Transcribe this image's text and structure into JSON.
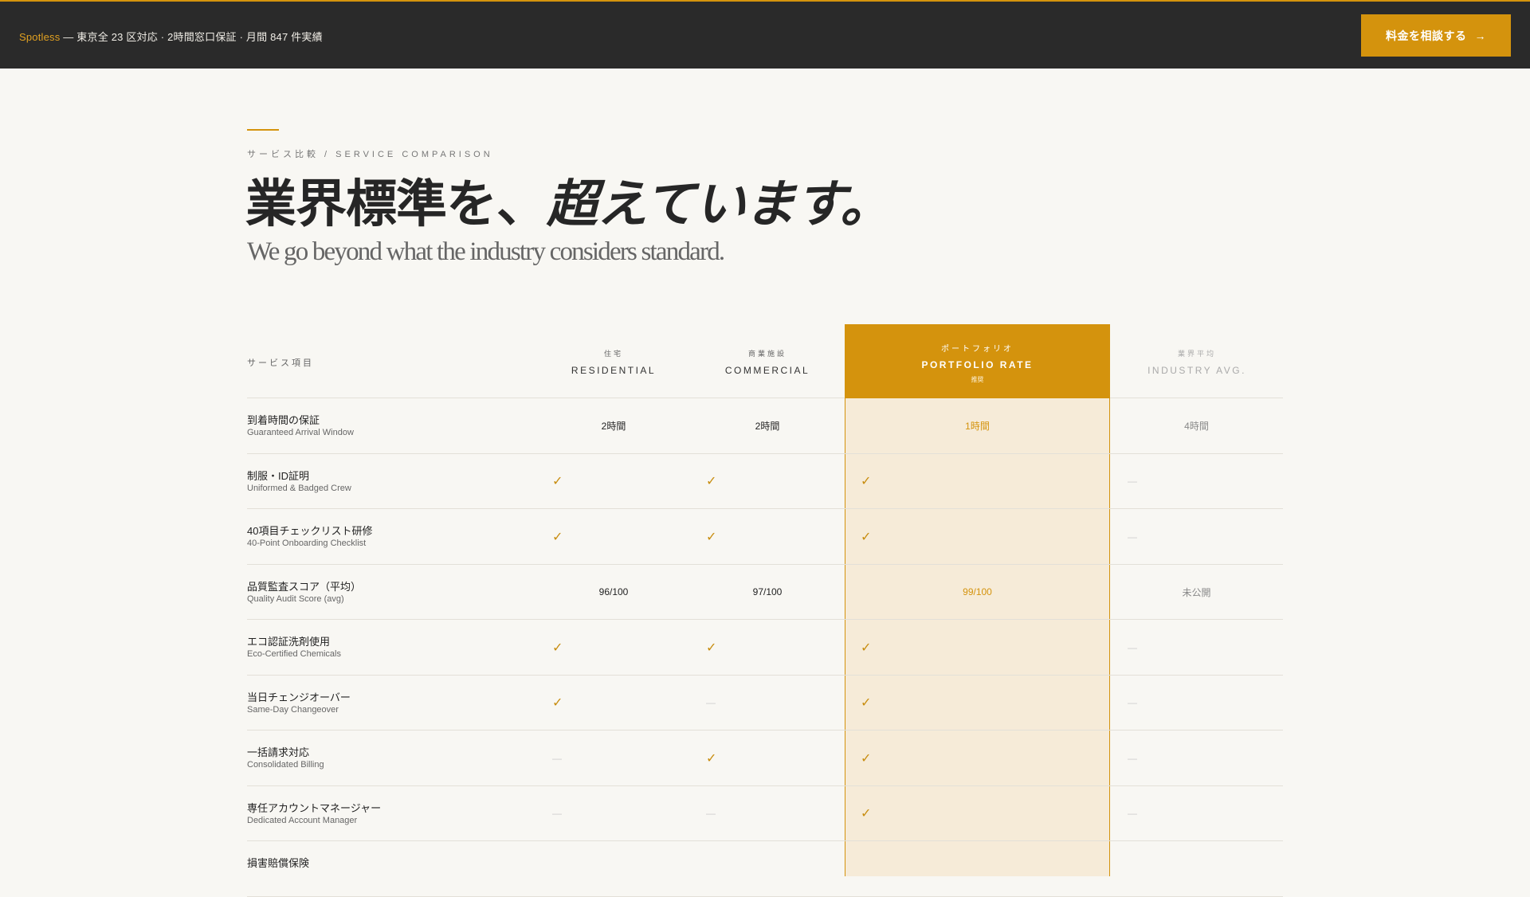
{
  "topbar": {
    "brand": "Spotless",
    "message": " — 東京全 23 区対応 · 2時間窓口保証 · 月間 847 件実績",
    "cta_label": "料金を相談する",
    "cta_icon": "arrow-right-icon"
  },
  "hero": {
    "eyebrow": "サービス比較 / SERVICE COMPARISON",
    "headline_main": "業界標準を、",
    "headline_italic": "超えています。",
    "subhead": "We go beyond what the industry considers standard."
  },
  "table": {
    "header_label": "サービス項目",
    "columns": [
      {
        "jp": "住宅",
        "en": "RESIDENTIAL"
      },
      {
        "jp": "商業施設",
        "en": "COMMERCIAL"
      },
      {
        "jp": "ポートフォリオ",
        "en": "PORTFOLIO RATE",
        "sub": "推奨"
      },
      {
        "jp": "業界平均",
        "en": "INDUSTRY AVG."
      }
    ],
    "rows": [
      {
        "jp": "到着時間の保証",
        "en": "Guaranteed Arrival Window",
        "res": "2時間",
        "com": "2時間",
        "por": "1時間",
        "ind": "4時間"
      },
      {
        "jp": "制服・ID証明",
        "en": "Uniformed & Badged Crew",
        "res": "check",
        "com": "check",
        "por": "check",
        "ind": "dash"
      },
      {
        "jp": "40項目チェックリスト研修",
        "en": "40-Point Onboarding Checklist",
        "res": "check",
        "com": "check",
        "por": "check",
        "ind": "dash"
      },
      {
        "jp": "品質監査スコア（平均）",
        "en": "Quality Audit Score (avg)",
        "res": "96/100",
        "com": "97/100",
        "por": "99/100",
        "ind": "未公開"
      },
      {
        "jp": "エコ認証洗剤使用",
        "en": "Eco-Certified Chemicals",
        "res": "check",
        "com": "check",
        "por": "check",
        "ind": "dash"
      },
      {
        "jp": "当日チェンジオーバー",
        "en": "Same-Day Changeover",
        "res": "check",
        "com": "dash",
        "por": "check",
        "ind": "dash"
      },
      {
        "jp": "一括請求対応",
        "en": "Consolidated Billing",
        "res": "dash",
        "com": "check",
        "por": "check",
        "ind": "dash"
      },
      {
        "jp": "専任アカウントマネージャー",
        "en": "Dedicated Account Manager",
        "res": "dash",
        "com": "dash",
        "por": "check",
        "ind": "dash"
      },
      {
        "jp": "損害賠償保険",
        "en": "",
        "res": "",
        "com": "",
        "por": "",
        "ind": ""
      }
    ]
  },
  "colors": {
    "accent": "#d4930d",
    "dark": "#2a2a2a",
    "bg": "#f8f7f3",
    "highlight": "#f6ebd8"
  }
}
